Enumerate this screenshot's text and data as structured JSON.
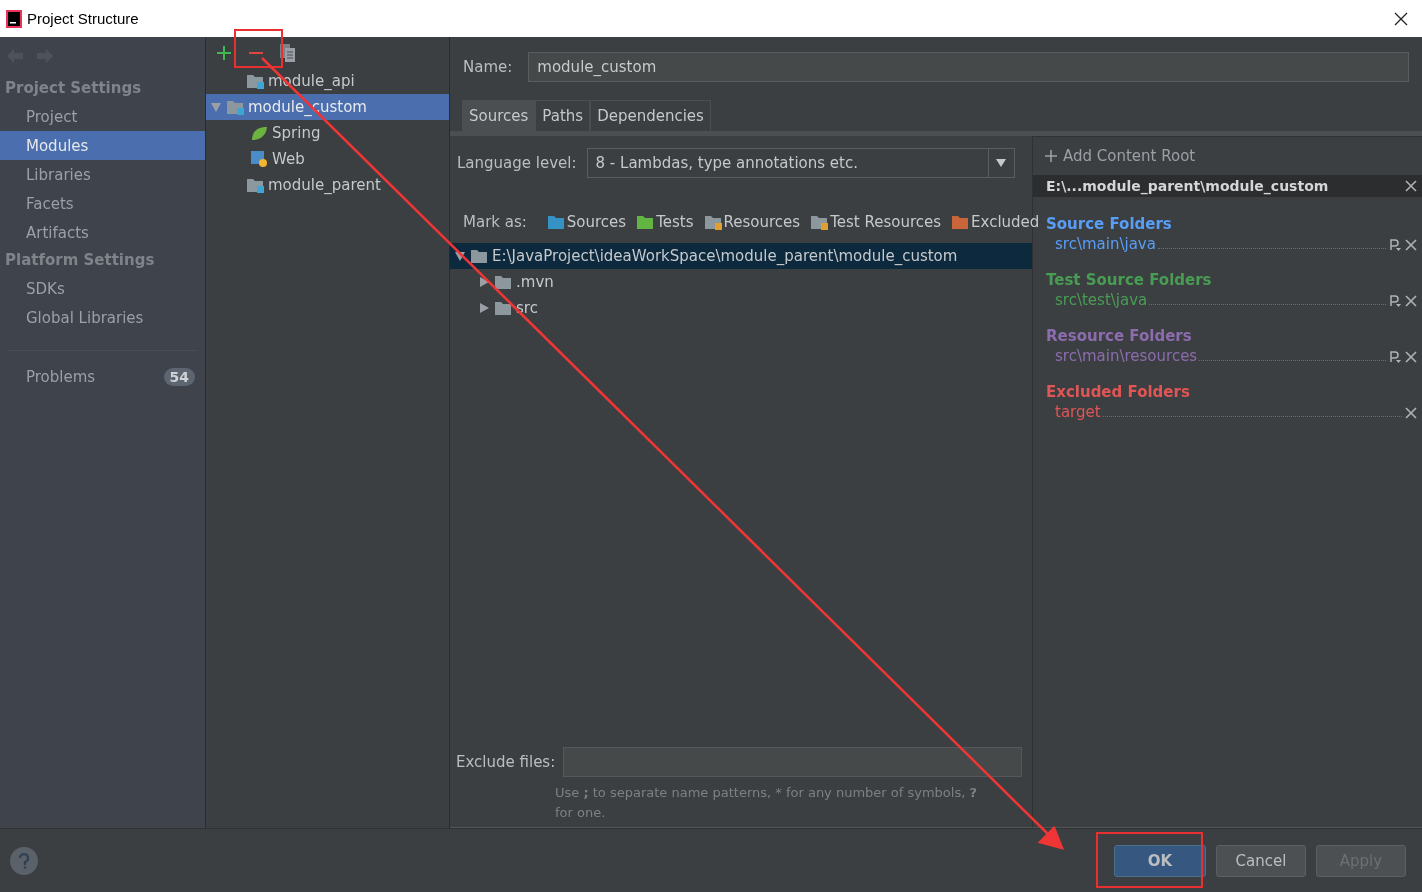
{
  "window": {
    "title": "Project Structure"
  },
  "sidebar": {
    "sections": [
      {
        "title": "Project Settings",
        "items": [
          {
            "label": "Project",
            "selected": false
          },
          {
            "label": "Modules",
            "selected": true
          },
          {
            "label": "Libraries",
            "selected": false
          },
          {
            "label": "Facets",
            "selected": false
          },
          {
            "label": "Artifacts",
            "selected": false
          }
        ]
      },
      {
        "title": "Platform Settings",
        "items": [
          {
            "label": "SDKs",
            "selected": false
          },
          {
            "label": "Global Libraries",
            "selected": false
          }
        ]
      }
    ],
    "problems": {
      "label": "Problems",
      "count": "54"
    }
  },
  "modules": [
    {
      "label": "module_api",
      "kind": "module",
      "selected": false
    },
    {
      "label": "module_custom",
      "kind": "module",
      "selected": true,
      "expanded": true,
      "children": [
        {
          "label": "Spring",
          "kind": "spring",
          "selected": false
        },
        {
          "label": "Web",
          "kind": "web",
          "selected": false
        }
      ]
    },
    {
      "label": "module_parent",
      "kind": "module",
      "selected": false
    }
  ],
  "name_field": {
    "label": "Name:",
    "value": "module_custom"
  },
  "tabs": [
    {
      "label": "Sources",
      "selected": true
    },
    {
      "label": "Paths",
      "selected": false
    },
    {
      "label": "Dependencies",
      "selected": false
    }
  ],
  "language_level": {
    "label": "Language level:",
    "value": "8 - Lambdas, type annotations etc."
  },
  "mark_as": {
    "label": "Mark as:",
    "items": [
      {
        "label": "Sources",
        "kind": "sources"
      },
      {
        "label": "Tests",
        "kind": "tests"
      },
      {
        "label": "Resources",
        "kind": "resources"
      },
      {
        "label": "Test Resources",
        "kind": "test_resources"
      },
      {
        "label": "Excluded",
        "kind": "excluded"
      }
    ]
  },
  "content_tree": [
    {
      "label": "E:\\JavaProject\\ideaWorkSpace\\module_parent\\module_custom",
      "expanded": true,
      "selected": true,
      "children": [
        {
          "label": ".mvn",
          "expanded": false,
          "selected": false
        },
        {
          "label": "src",
          "expanded": false,
          "selected": false
        }
      ]
    }
  ],
  "roots_panel": {
    "add_label": "Add Content Root",
    "root": "E:\\...module_parent\\module_custom",
    "groups": [
      {
        "title": "Source Folders",
        "color": "#589df6",
        "entries": [
          {
            "path": "src\\main\\java",
            "properties": true
          }
        ]
      },
      {
        "title": "Test Source Folders",
        "color": "#499c54",
        "entries": [
          {
            "path": "src\\test\\java",
            "properties": true
          }
        ]
      },
      {
        "title": "Resource Folders",
        "color": "#8c6cae",
        "entries": [
          {
            "path": "src\\main\\resources",
            "properties": true
          }
        ]
      },
      {
        "title": "Excluded Folders",
        "color": "#e05555",
        "entries": [
          {
            "path": "target",
            "properties": false
          }
        ]
      }
    ]
  },
  "exclude_files": {
    "label": "Exclude files:",
    "hint": "Use **;** to separate name patterns, * for any number of symbols, **?** for one."
  },
  "buttons": [
    {
      "label": "OK",
      "kind": "primary",
      "disabled": false
    },
    {
      "label": "Cancel",
      "kind": "normal",
      "disabled": false
    },
    {
      "label": "Apply",
      "kind": "normal",
      "disabled": true
    }
  ]
}
